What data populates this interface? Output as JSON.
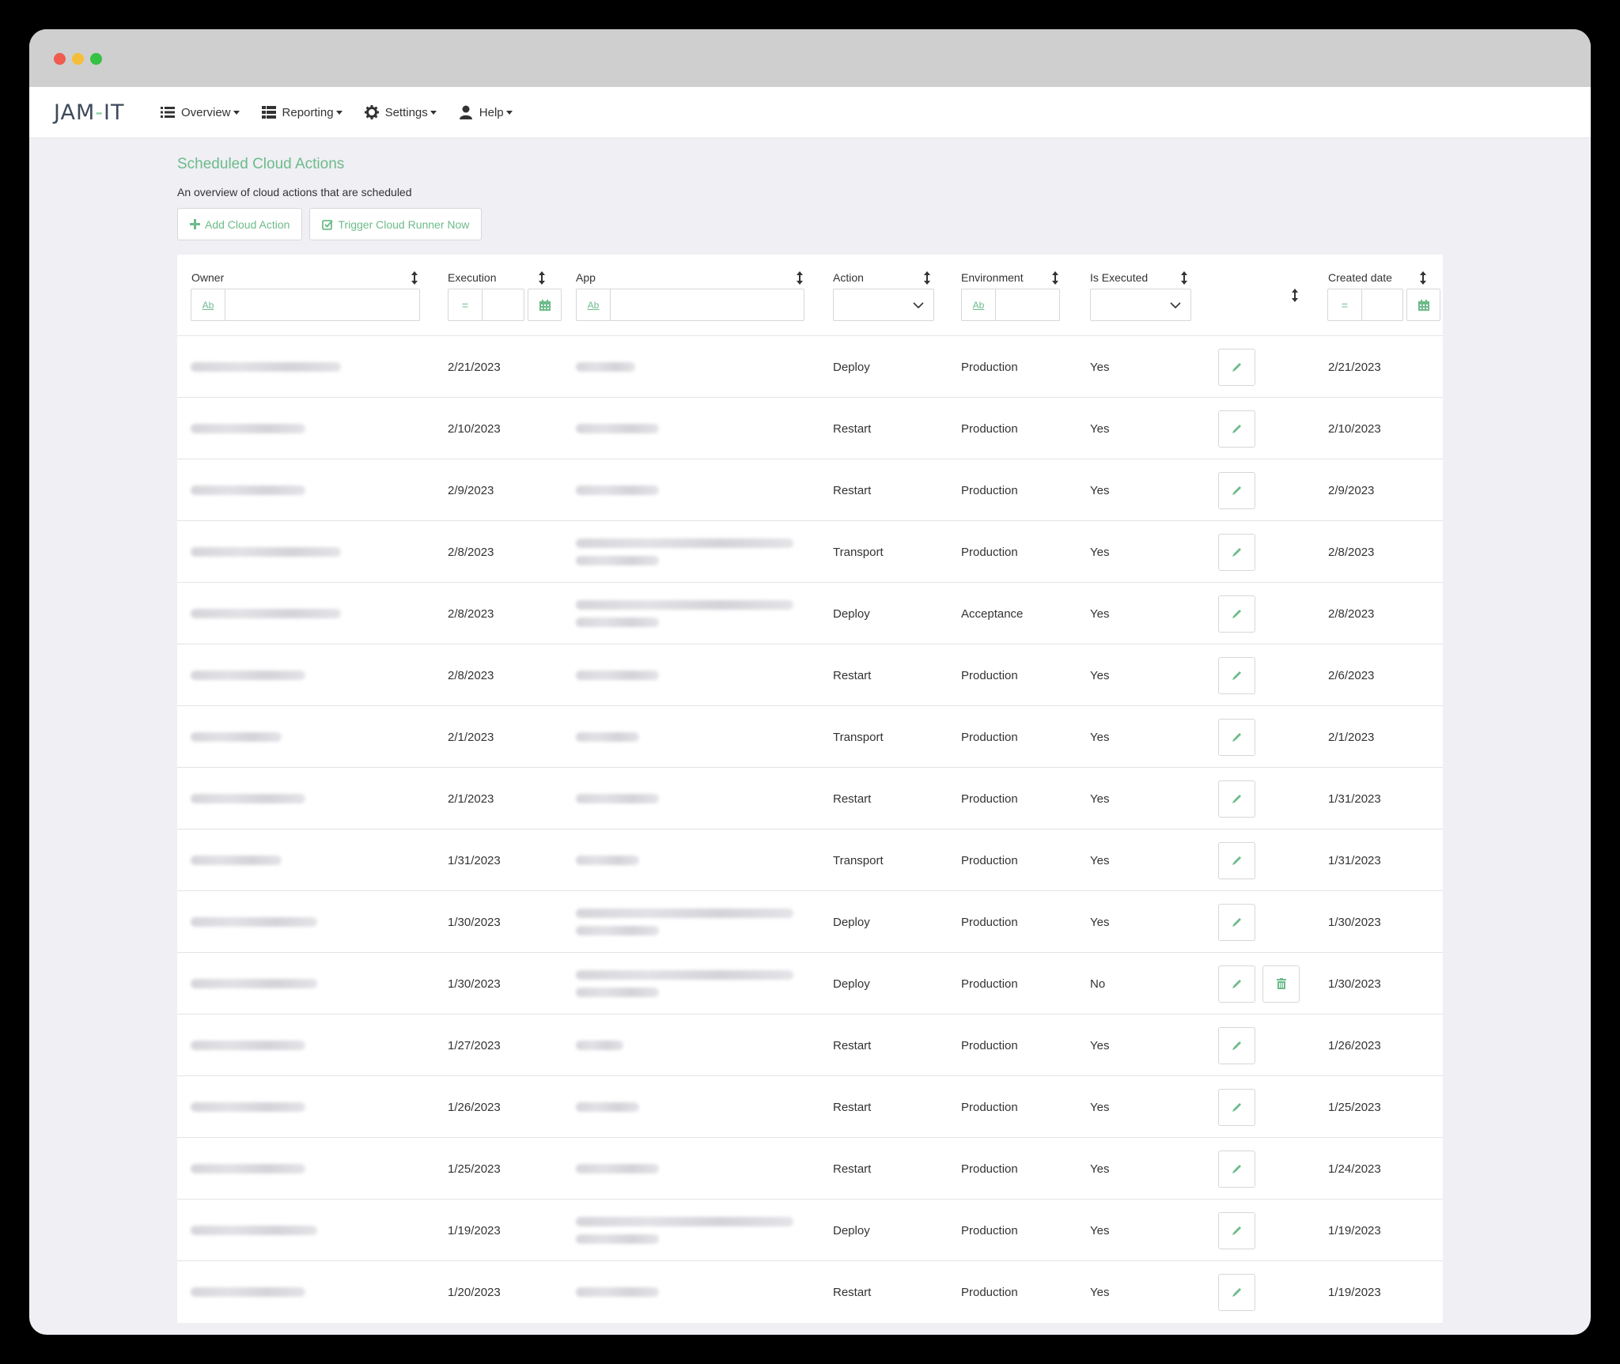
{
  "nav": {
    "logo_left": "JAM",
    "logo_dash": "-",
    "logo_right": "IT",
    "items": [
      {
        "label": "Overview",
        "icon": "list-icon"
      },
      {
        "label": "Reporting",
        "icon": "table-icon"
      },
      {
        "label": "Settings",
        "icon": "gear-icon"
      },
      {
        "label": "Help",
        "icon": "user-icon"
      }
    ]
  },
  "page": {
    "title": "Scheduled Cloud Actions",
    "subtitle": "An overview of cloud actions that are scheduled",
    "add_button": "Add Cloud Action",
    "trigger_button": "Trigger Cloud Runner Now"
  },
  "filters": {
    "text_badge": "Ab",
    "eq_badge": "="
  },
  "columns": [
    "Owner",
    "Execution",
    "App",
    "Action",
    "Environment",
    "Is Executed",
    "",
    "Created date"
  ],
  "colors": {
    "accent": "#6dbb8a"
  },
  "rows": [
    {
      "execution": "2/21/2023",
      "action": "Deploy",
      "environment": "Production",
      "executed": "Yes",
      "created": "2/21/2023",
      "owner_w": 190,
      "app_w": 75,
      "app_lines": 1,
      "delete": false
    },
    {
      "execution": "2/10/2023",
      "action": "Restart",
      "environment": "Production",
      "executed": "Yes",
      "created": "2/10/2023",
      "owner_w": 145,
      "app_w": 105,
      "app_lines": 1,
      "delete": false
    },
    {
      "execution": "2/9/2023",
      "action": "Restart",
      "environment": "Production",
      "executed": "Yes",
      "created": "2/9/2023",
      "owner_w": 145,
      "app_w": 105,
      "app_lines": 1,
      "delete": false
    },
    {
      "execution": "2/8/2023",
      "action": "Transport",
      "environment": "Production",
      "executed": "Yes",
      "created": "2/8/2023",
      "owner_w": 190,
      "app_w": 275,
      "app_lines": 2,
      "delete": false
    },
    {
      "execution": "2/8/2023",
      "action": "Deploy",
      "environment": "Acceptance",
      "executed": "Yes",
      "created": "2/8/2023",
      "owner_w": 190,
      "app_w": 275,
      "app_lines": 2,
      "delete": false
    },
    {
      "execution": "2/8/2023",
      "action": "Restart",
      "environment": "Production",
      "executed": "Yes",
      "created": "2/6/2023",
      "owner_w": 145,
      "app_w": 105,
      "app_lines": 1,
      "delete": false
    },
    {
      "execution": "2/1/2023",
      "action": "Transport",
      "environment": "Production",
      "executed": "Yes",
      "created": "2/1/2023",
      "owner_w": 115,
      "app_w": 80,
      "app_lines": 1,
      "delete": false
    },
    {
      "execution": "2/1/2023",
      "action": "Restart",
      "environment": "Production",
      "executed": "Yes",
      "created": "1/31/2023",
      "owner_w": 145,
      "app_w": 105,
      "app_lines": 1,
      "delete": false
    },
    {
      "execution": "1/31/2023",
      "action": "Transport",
      "environment": "Production",
      "executed": "Yes",
      "created": "1/31/2023",
      "owner_w": 115,
      "app_w": 80,
      "app_lines": 1,
      "delete": false
    },
    {
      "execution": "1/30/2023",
      "action": "Deploy",
      "environment": "Production",
      "executed": "Yes",
      "created": "1/30/2023",
      "owner_w": 160,
      "app_w": 275,
      "app_lines": 2,
      "delete": false
    },
    {
      "execution": "1/30/2023",
      "action": "Deploy",
      "environment": "Production",
      "executed": "No",
      "created": "1/30/2023",
      "owner_w": 160,
      "app_w": 275,
      "app_lines": 2,
      "delete": true
    },
    {
      "execution": "1/27/2023",
      "action": "Restart",
      "environment": "Production",
      "executed": "Yes",
      "created": "1/26/2023",
      "owner_w": 145,
      "app_w": 60,
      "app_lines": 1,
      "delete": false
    },
    {
      "execution": "1/26/2023",
      "action": "Restart",
      "environment": "Production",
      "executed": "Yes",
      "created": "1/25/2023",
      "owner_w": 145,
      "app_w": 80,
      "app_lines": 1,
      "delete": false
    },
    {
      "execution": "1/25/2023",
      "action": "Restart",
      "environment": "Production",
      "executed": "Yes",
      "created": "1/24/2023",
      "owner_w": 145,
      "app_w": 105,
      "app_lines": 1,
      "delete": false
    },
    {
      "execution": "1/19/2023",
      "action": "Deploy",
      "environment": "Production",
      "executed": "Yes",
      "created": "1/19/2023",
      "owner_w": 160,
      "app_w": 275,
      "app_lines": 2,
      "delete": false
    },
    {
      "execution": "1/20/2023",
      "action": "Restart",
      "environment": "Production",
      "executed": "Yes",
      "created": "1/19/2023",
      "owner_w": 145,
      "app_w": 105,
      "app_lines": 1,
      "delete": false
    }
  ]
}
